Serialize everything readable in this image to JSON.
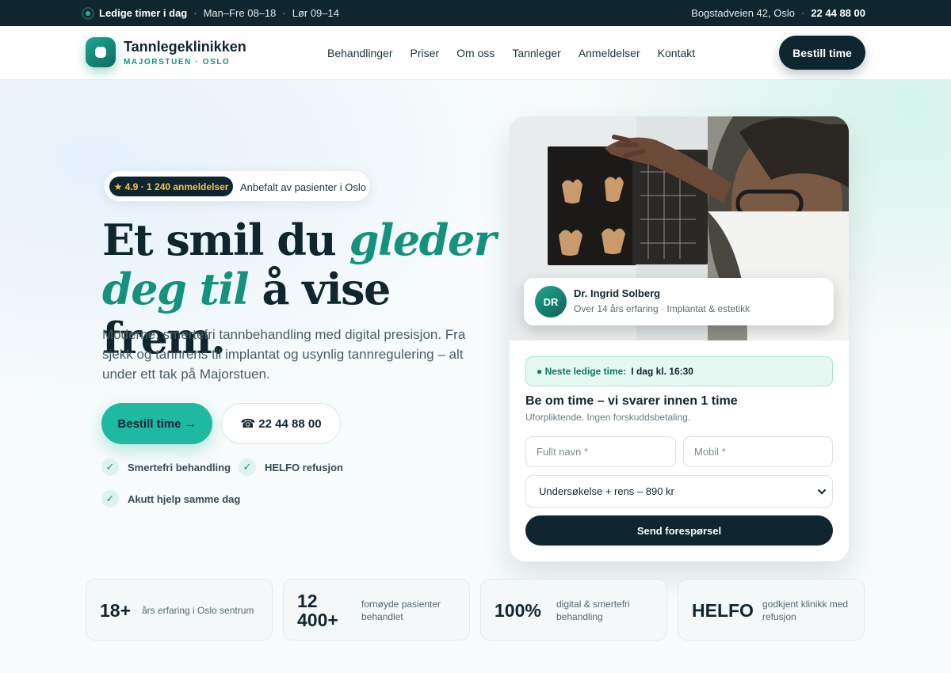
{
  "topbar": {
    "availability": "Ledige timer i dag",
    "hours_weekday": "Man–Fre 08–18",
    "hours_saturday": "Lør 09–14",
    "address": "Bogstadveien 42, Oslo",
    "phone": "22 44 88 00",
    "separator": "·"
  },
  "header": {
    "brand_name": "Tannlegeklinikken",
    "brand_sub": "MAJORSTUEN · OSLO",
    "nav": [
      "Behandlinger",
      "Priser",
      "Om oss",
      "Tannleger",
      "Anmeldelser",
      "Kontakt"
    ],
    "cta": "Bestill time"
  },
  "hero": {
    "rating_badge": "★ 4.9 · 1 240 anmeldelser",
    "rating_text": "Anbefalt av pasienter i Oslo",
    "headline_part1": "Et smil du ",
    "headline_accent1": "gleder",
    "headline_accent2": "deg til",
    "headline_part2": " å vise frem.",
    "lead": "Moderne, smertefri tannbehandling med digital presisjon. Fra sjekk og tannrens til implantat og usynlig tannregulering – alt under ett tak på Majorstuen.",
    "primary_button": "Bestill time →",
    "phone_button": "☎ 22 44 88 00",
    "checks": [
      "Smertefri behandling",
      "HELFO refusjon",
      "Akutt hjelp samme dag"
    ],
    "check_glyph": "✓"
  },
  "booking": {
    "doctor_initials": "DR",
    "doctor_name": "Dr. Ingrid Solberg",
    "doctor_meta": "Over 14 års erfaring · Implantat & estetikk",
    "next_slot_label": "● Neste ledige time:",
    "next_slot_value": "I dag kl. 16:30",
    "title": "Be om time – vi svarer innen 1 time",
    "subtitle": "Uforpliktende. Ingen forskuddsbetaling.",
    "name_placeholder": "Fullt navn *",
    "mobile_placeholder": "Mobil *",
    "treatment_selected": "Undersøkelse + rens – 890 kr",
    "submit": "Send forespørsel"
  },
  "stats": [
    {
      "value": "18+",
      "label": "års erfaring i Oslo sentrum"
    },
    {
      "value": "12 400+",
      "label": "fornøyde pasienter behandlet"
    },
    {
      "value": "100%",
      "label": "digital & smertefri behandling"
    },
    {
      "value": "HELFO",
      "label": "godkjent klinikk med refusjon"
    }
  ],
  "colors": {
    "dark": "#0f2530",
    "accent": "#1fb8a0",
    "accent_dark": "#14927d"
  },
  "icons": [
    "status-dot-icon",
    "logo-icon",
    "star-icon",
    "phone-icon",
    "check-icon",
    "chevron-down-icon"
  ]
}
